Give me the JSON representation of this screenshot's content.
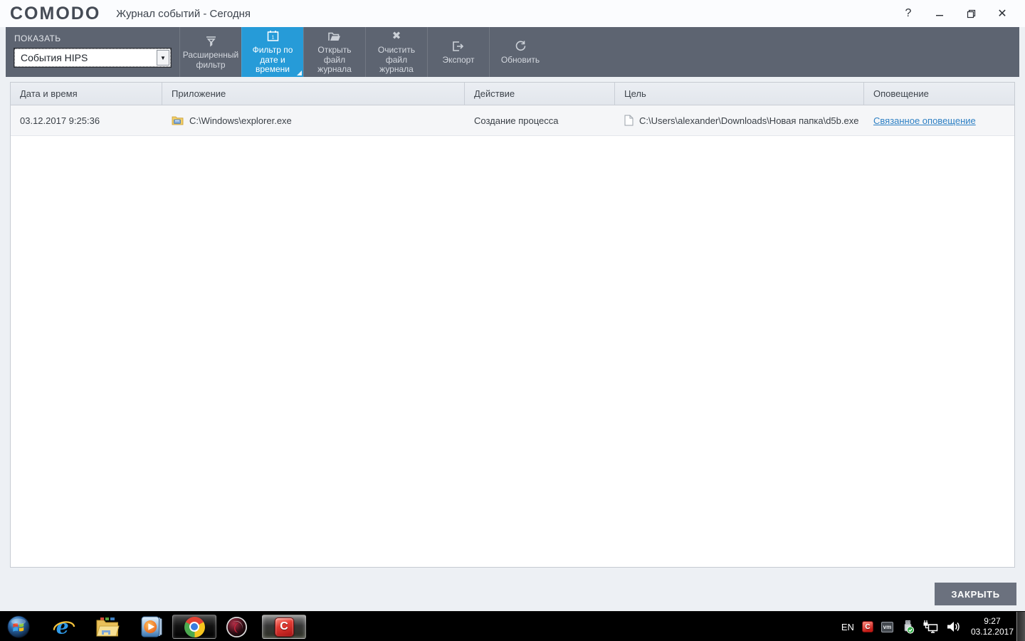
{
  "window": {
    "logo": "COMODO",
    "title": "Журнал событий - Сегодня",
    "controls": {
      "help": "?",
      "minimize": "—",
      "close": "✕"
    }
  },
  "toolbar": {
    "show_label": "ПОКАЗАТЬ",
    "filter_select": {
      "value": "События HIPS"
    },
    "buttons": [
      {
        "label": "Расширенный фильтр",
        "icon": "advanced-filter-icon",
        "active": false
      },
      {
        "label": "Фильтр по дате и времени",
        "icon": "date-time-filter-icon",
        "active": true
      },
      {
        "label": "Открыть файл журнала",
        "icon": "open-log-file-icon",
        "active": false
      },
      {
        "label": "Очистить файл журнала",
        "icon": "clear-log-file-icon",
        "active": false
      },
      {
        "label": "Экспорт",
        "icon": "export-icon",
        "active": false
      },
      {
        "label": "Обновить",
        "icon": "refresh-icon",
        "active": false
      }
    ]
  },
  "table": {
    "columns": [
      "Дата и время",
      "Приложение",
      "Действие",
      "Цель",
      "Оповещение"
    ],
    "rows": [
      {
        "datetime": "03.12.2017 9:25:36",
        "application": "C:\\Windows\\explorer.exe",
        "action": "Создание процесса",
        "target": "C:\\Users\\alexander\\Downloads\\Новая папка\\d5b.exe",
        "alert_link": "Связанное оповещение"
      }
    ]
  },
  "footer": {
    "close_button": "ЗАКРЫТЬ"
  },
  "taskbar": {
    "comodo_letter": "C",
    "ie_letter": "e",
    "vm_label": "vm",
    "tray": {
      "language": "EN",
      "comodo_letter": "C",
      "time": "9:27",
      "date": "03.12.2017"
    }
  },
  "icons": {
    "dropdown_arrow": "▼",
    "clear_x": "✖"
  },
  "colors": {
    "accent_blue": "#269bd8",
    "toolbar_gray": "#5d6471",
    "link_blue": "#2e80c4",
    "comodo_red": "#d42027",
    "close_button_gray": "#6b717e"
  }
}
